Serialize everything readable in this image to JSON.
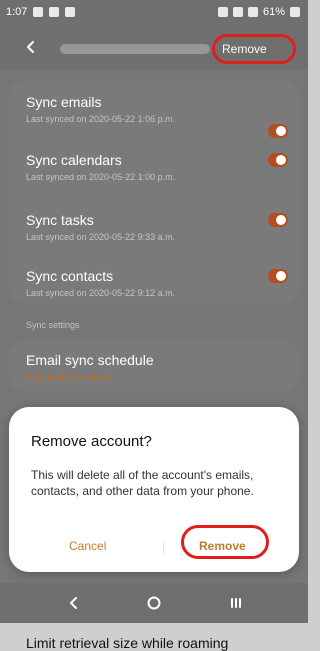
{
  "status_bar": {
    "time": "1:07",
    "battery": "61%"
  },
  "toolbar": {
    "remove_label": "Remove"
  },
  "sync_items": [
    {
      "title": "Sync emails",
      "subtitle": "Last synced on 2020-05-22 1:06 p.m."
    },
    {
      "title": "Sync calendars",
      "subtitle": "Last synced on 2020-05-22 1:00 p.m."
    },
    {
      "title": "Sync tasks",
      "subtitle": "Last synced on 2020-05-22 9:33 a.m."
    },
    {
      "title": "Sync contacts",
      "subtitle": "Last synced on 2020-05-22 9:12 a.m."
    }
  ],
  "sections": {
    "sync_settings": "Sync settings"
  },
  "email_sync_schedule": {
    "title": "Email sync schedule",
    "subtitle": "Auto (when received)"
  },
  "dialog": {
    "title": "Remove account?",
    "body": "This will delete all of the account's emails, contacts, and other data from your phone.",
    "cancel": "Cancel",
    "remove": "Remove"
  },
  "bottom_item": {
    "title": "Limit retrieval size while roaming"
  },
  "colors": {
    "accent": "#c57a2b",
    "toggle_on": "#b34e23",
    "highlight": "#e11d1d"
  }
}
